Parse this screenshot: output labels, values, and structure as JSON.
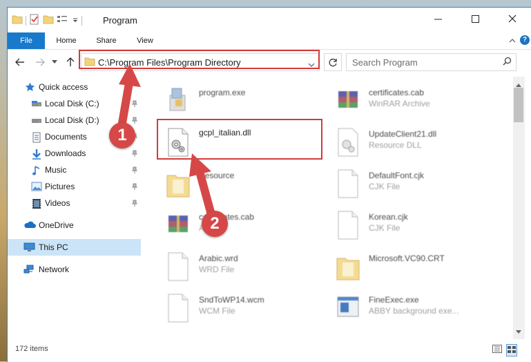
{
  "window": {
    "title": "Program"
  },
  "ribbon": {
    "tabs": [
      "File",
      "Home",
      "Share",
      "View"
    ]
  },
  "address": {
    "path": "C:\\Program Files\\Program Directory"
  },
  "search": {
    "placeholder": "Search Program"
  },
  "nav": {
    "items": [
      {
        "label": "Quick access",
        "icon": "star-icon"
      },
      {
        "label": "Local Disk (C:)",
        "icon": "drive-icon"
      },
      {
        "label": "Local Disk (D:)",
        "icon": "drive-icon"
      },
      {
        "label": "Documents",
        "icon": "documents-icon"
      },
      {
        "label": "Downloads",
        "icon": "downloads-icon"
      },
      {
        "label": "Music",
        "icon": "music-icon"
      },
      {
        "label": "Pictures",
        "icon": "pictures-icon"
      },
      {
        "label": "Videos",
        "icon": "videos-icon"
      },
      {
        "label": "OneDrive",
        "icon": "cloud-icon"
      },
      {
        "label": "This PC",
        "icon": "computer-icon"
      },
      {
        "label": "Network",
        "icon": "network-icon"
      }
    ]
  },
  "files": [
    {
      "name": "program.exe",
      "type": "",
      "icon": "exe"
    },
    {
      "name": "certificates.cab",
      "type": "WinRAR Archive",
      "icon": "rar"
    },
    {
      "name": "gcpl_italian.dll",
      "type": "",
      "icon": "dll"
    },
    {
      "name": "UpdateClient21.dll",
      "type": "Resource DLL",
      "icon": "dll"
    },
    {
      "name": "Resource",
      "type": "",
      "icon": "folder"
    },
    {
      "name": "DefaultFont.cjk",
      "type": "CJK File",
      "icon": "doc"
    },
    {
      "name": "certificates.cab",
      "type": "Archive",
      "icon": "rar"
    },
    {
      "name": "Korean.cjk",
      "type": "CJK File",
      "icon": "doc"
    },
    {
      "name": "Arabic.wrd",
      "type": "WRD File",
      "icon": "doc"
    },
    {
      "name": "Microsoft.VC90.CRT",
      "type": "",
      "icon": "folder"
    },
    {
      "name": "SndToWP14.wcm",
      "type": "WCM File",
      "icon": "doc"
    },
    {
      "name": "FineExec.exe",
      "type": "ABBY background exe...",
      "icon": "app"
    }
  ],
  "status": {
    "count": "172 items"
  },
  "annotations": {
    "step1": "1",
    "step2": "2",
    "color": "#d64848"
  }
}
